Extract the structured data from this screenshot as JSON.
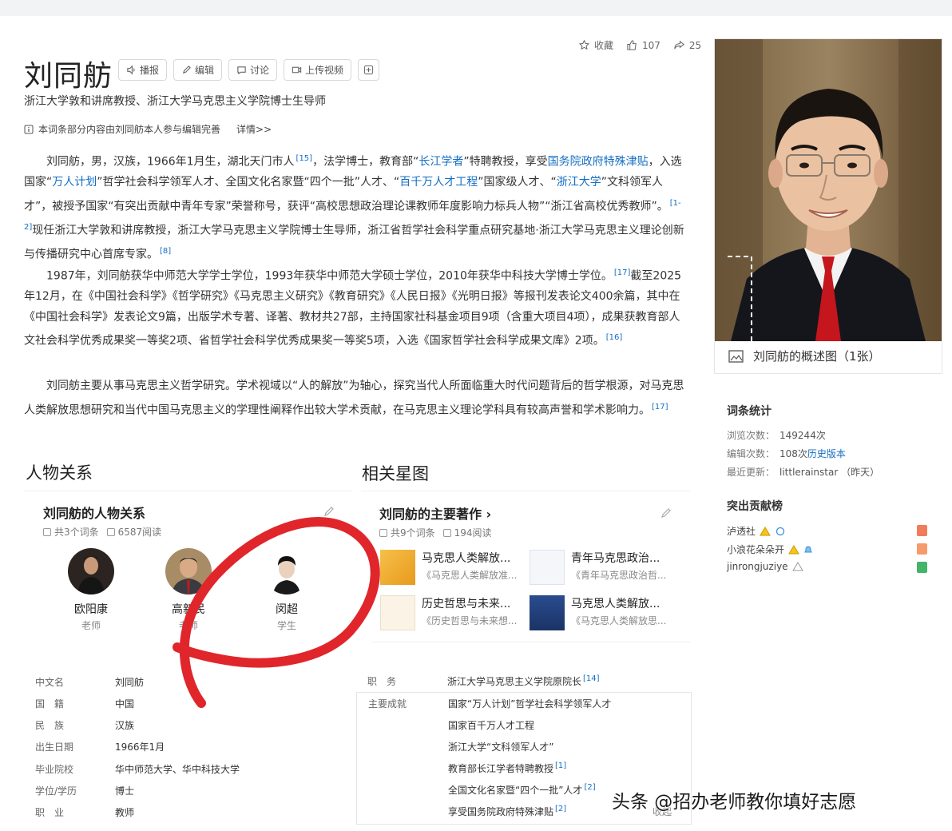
{
  "header": {
    "title": "刘同舫",
    "tools": [
      "播报",
      "编辑",
      "讨论",
      "上传视频"
    ],
    "actions": {
      "collect": "收藏",
      "likes": "107",
      "shares": "25"
    }
  },
  "subtitle": "浙江大学敦和讲席教授、浙江大学马克思主义学院博士生导师",
  "notice": {
    "text": "本词条部分内容由刘同舫本人参与编辑完善",
    "more": "详情>>"
  },
  "summary": {
    "p1": {
      "s1": "刘同舫，男，汉族，1966年1月生，湖北天门市人",
      "r1": "[15]",
      "s2": "，法学博士，教育部“",
      "l1": "长江学者",
      "s3": "”特聘教授，享受",
      "l2": "国务院政府特殊津贴",
      "s4": "，入选国家“",
      "l3": "万人计划",
      "s5": "”哲学社会科学领军人才、全国文化名家暨“四个一批”人才、“",
      "l4": "百千万人才工程",
      "s6": "”国家级人才、“",
      "l5": "浙江大学",
      "s7": "”文科领军人才”，被授予国家“有突出贡献中青年专家”荣誉称号，获评“高校思想政治理论课教师年度影响力标兵人物”“浙江省高校优秀教师”。",
      "r2": "[1-2]",
      "s8": "现任浙江大学敦和讲席教授，浙江大学马克思主义学院博士生导师，浙江省哲学社会科学重点研究基地·浙江大学马克思主义理论创新与传播研究中心首席专家。",
      "r3": "[8]"
    },
    "p2": {
      "s1": "1987年，刘同舫获华中师范大学学士学位，1993年获华中师范大学硕士学位，2010年获华中科技大学博士学位。",
      "r1": "[17]",
      "s2": "截至2025年12月，在《中国社会科学》《哲学研究》《马克思主义研究》《教育研究》《人民日报》《光明日报》等报刊发表论文400余篇，其中在《中国社会科学》发表论文9篇，出版学术专著、译著、教材共27部，主持国家社科基金项目9项（含重大项目4项），成果获教育部人文社会科学优秀成果奖一等奖2项、省哲学社会科学优秀成果奖一等奖5项，入选《国家哲学社会科学成果文库》2项。",
      "r2": "[16]"
    },
    "p3": {
      "s1": "刘同舫主要从事马克思主义哲学研究。学术视域以“人的解放”为轴心，探究当代人所面临重大时代问题背后的哲学根源，对马克思人类解放思想研究和当代中国马克思主义的学理性阐释作出较大学术贡献，在马克思主义理论学科具有较高声誉和学术影响力。",
      "r1": "[17]"
    }
  },
  "photo": {
    "caption": "刘同舫的概述图（1张）"
  },
  "stats": {
    "title": "词条统计",
    "views_label": "浏览次数：",
    "views": "149244次",
    "edits_label": "编辑次数：",
    "edits": "108次",
    "history": "历史版本",
    "updated_label": "最近更新：",
    "updated": "littlerainstar （昨天）"
  },
  "contrib": {
    "title": "突出贡献榜",
    "users": [
      "泸透社",
      "小浪花朵朵开",
      "jinrongjuziye"
    ]
  },
  "relations": {
    "section_title": "人物关系",
    "card_title": "刘同舫的人物关系",
    "count": "共3个词条",
    "reads": "6587阅读",
    "people": [
      {
        "name": "欧阳康",
        "role": "老师"
      },
      {
        "name": "高新民",
        "role": "老师"
      },
      {
        "name": "闵超",
        "role": "学生"
      }
    ]
  },
  "stars": {
    "section_title": "相关星图",
    "card_title": "刘同舫的主要著作 ›",
    "count": "共9个词条",
    "reads": "194阅读",
    "works": [
      {
        "title": "马克思人类解放...",
        "sub": "《马克思人类解放准..."
      },
      {
        "title": "青年马克思政治...",
        "sub": "《青年马克思政治哲..."
      },
      {
        "title": "历史哲思与未来...",
        "sub": "《历史哲思与未来想..."
      },
      {
        "title": "马克思人类解放...",
        "sub": "《马克思人类解放思..."
      }
    ]
  },
  "basic_info": [
    {
      "k": "中文名",
      "v": "刘同舫"
    },
    {
      "k": "国　籍",
      "v": "中国"
    },
    {
      "k": "民　族",
      "v": "汉族"
    },
    {
      "k": "出生日期",
      "v": "1966年1月"
    },
    {
      "k": "毕业院校",
      "v": "华中师范大学、华中科技大学"
    },
    {
      "k": "学位/学历",
      "v": "博士"
    },
    {
      "k": "职　业",
      "v": "教师"
    }
  ],
  "duties": {
    "k": "职　务",
    "v": "浙江大学马克思主义学院",
    "v2": "原院长",
    "ref": "[14]"
  },
  "honors": {
    "k": "主要成就",
    "items": [
      "国家“万人计划”哲学社会科学领军人才",
      "国家百千万人才工程",
      "浙江大学“文科领军人才”",
      "教育部长江学者特聘教授",
      "全国文化名家暨“四个一批”人才",
      "享受国务院政府特殊津贴"
    ],
    "refs": [
      "[1]",
      "[2]",
      "[2]"
    ],
    "collapse": "收起"
  },
  "watermark": "头条 @招办老师教你填好志愿",
  "colors": {
    "link": "#136ec2",
    "mark": "#e0262b"
  }
}
